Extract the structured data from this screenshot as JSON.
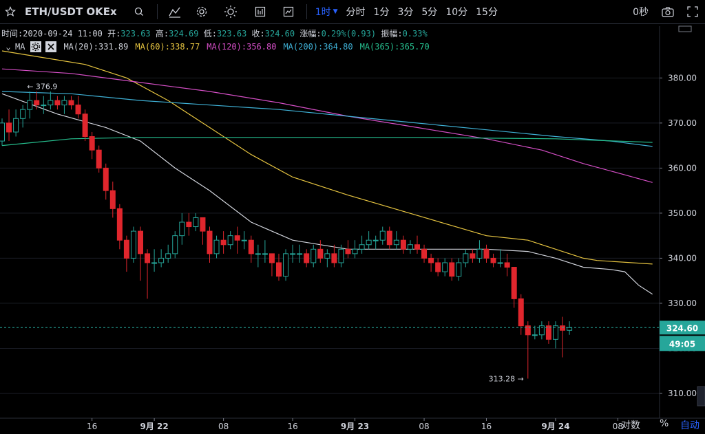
{
  "toolbar": {
    "symbol": "ETH/USDT OKEx",
    "intervals": [
      "1时",
      "分时",
      "1分",
      "3分",
      "5分",
      "10分",
      "15分"
    ],
    "active_interval": "1时",
    "countdown": "0秒"
  },
  "info": {
    "time_label": "时间:",
    "time": "2020-09-24 11:00",
    "open_label": "开:",
    "open": "323.63",
    "high_label": "高:",
    "high": "324.69",
    "low_label": "低:",
    "low": "323.63",
    "close_label": "收:",
    "close": "324.60",
    "change_label": "涨幅:",
    "change": "0.29%(0.93)",
    "amp_label": "振幅:",
    "amp": "0.33%"
  },
  "ma_legend": {
    "title": "MA",
    "items": [
      {
        "label": "MA(20):331.89",
        "color": "#d1d4dc"
      },
      {
        "label": "MA(60):338.77",
        "color": "#e6c440"
      },
      {
        "label": "MA(120):356.80",
        "color": "#d64fc7"
      },
      {
        "label": "MA(200):364.80",
        "color": "#3fb1d6"
      },
      {
        "label": "MA(365):365.70",
        "color": "#26c08f"
      }
    ]
  },
  "chart_data": {
    "type": "candlestick",
    "ylim": [
      304.5,
      391.5
    ],
    "yticks": [
      310,
      320,
      330,
      340,
      350,
      360,
      370,
      380
    ],
    "ytick_labels": [
      "310.00",
      "320.00",
      "330.00",
      "340.00",
      "350.00",
      "360.00",
      "370.00",
      "380.00"
    ],
    "xtick_labels": [
      "16",
      "9月 22",
      "08",
      "16",
      "9月 23",
      "08",
      "16",
      "9月 24",
      "08"
    ],
    "current_price": 324.6,
    "current_price_label": "324.60",
    "countdown_label": "49:05",
    "high_annotation": {
      "text": "← 376.9",
      "value": 376.9
    },
    "low_annotation": {
      "text": "313.28 →",
      "value": 313.28
    },
    "candles": [
      [
        366,
        370,
        371,
        365
      ],
      [
        370,
        368,
        373,
        366
      ],
      [
        368,
        371,
        373,
        367
      ],
      [
        371,
        373,
        374,
        369
      ],
      [
        373,
        375,
        377,
        371
      ],
      [
        375,
        374,
        377,
        373
      ],
      [
        374,
        374,
        376,
        372
      ],
      [
        374,
        375,
        377,
        373
      ],
      [
        375,
        374,
        376,
        373
      ],
      [
        374,
        375,
        376,
        372
      ],
      [
        375,
        374,
        376,
        373
      ],
      [
        374,
        372,
        376,
        371
      ],
      [
        372,
        367,
        373,
        366
      ],
      [
        367,
        364,
        368,
        362
      ],
      [
        364,
        360,
        365,
        359
      ],
      [
        360,
        355,
        361,
        353
      ],
      [
        355,
        351,
        357,
        349
      ],
      [
        351,
        344,
        352,
        342
      ],
      [
        344,
        340,
        345,
        337
      ],
      [
        340,
        346,
        347,
        339
      ],
      [
        346,
        341,
        347,
        335
      ],
      [
        341,
        339,
        342,
        331
      ],
      [
        339,
        339,
        342,
        337
      ],
      [
        339,
        340,
        342,
        338
      ],
      [
        340,
        341,
        343,
        339
      ],
      [
        341,
        345,
        346,
        340
      ],
      [
        345,
        348,
        350,
        343
      ],
      [
        348,
        347,
        350,
        345
      ],
      [
        347,
        349,
        350,
        346
      ],
      [
        349,
        346,
        349,
        343
      ],
      [
        346,
        341,
        347,
        339
      ],
      [
        341,
        344,
        345,
        340
      ],
      [
        344,
        343,
        346,
        341
      ],
      [
        343,
        345,
        346,
        342
      ],
      [
        345,
        344,
        347,
        341
      ],
      [
        344,
        344,
        346,
        342
      ],
      [
        344,
        341,
        345,
        339
      ],
      [
        341,
        341,
        343,
        338
      ],
      [
        341,
        341,
        344,
        339
      ],
      [
        341,
        339,
        341,
        336
      ],
      [
        339,
        336,
        341,
        335
      ],
      [
        336,
        341,
        342,
        335
      ],
      [
        341,
        341,
        343,
        339
      ],
      [
        341,
        341,
        343,
        339
      ],
      [
        341,
        339,
        342,
        338
      ],
      [
        339,
        342,
        343,
        338
      ],
      [
        342,
        340,
        344,
        339
      ],
      [
        340,
        341,
        342,
        338
      ],
      [
        341,
        339,
        343,
        338
      ],
      [
        339,
        342,
        343,
        338
      ],
      [
        342,
        341,
        344,
        340
      ],
      [
        341,
        342,
        344,
        340
      ],
      [
        342,
        343,
        345,
        341
      ],
      [
        343,
        344,
        346,
        342
      ],
      [
        344,
        344,
        345,
        342
      ],
      [
        344,
        346,
        347,
        343
      ],
      [
        346,
        343,
        347,
        342
      ],
      [
        343,
        344,
        346,
        342
      ],
      [
        344,
        342,
        345,
        341
      ],
      [
        342,
        343,
        344,
        341
      ],
      [
        343,
        342,
        345,
        341
      ],
      [
        342,
        340,
        343,
        339
      ],
      [
        340,
        339,
        341,
        337
      ],
      [
        339,
        337,
        340,
        336
      ],
      [
        337,
        339,
        340,
        336
      ],
      [
        339,
        336,
        340,
        335
      ],
      [
        336,
        339,
        340,
        335
      ],
      [
        339,
        341,
        342,
        338
      ],
      [
        341,
        340,
        342,
        339
      ],
      [
        340,
        342,
        344,
        339
      ],
      [
        342,
        340,
        343,
        339
      ],
      [
        340,
        339,
        341,
        338
      ],
      [
        339,
        339,
        342,
        338
      ],
      [
        339,
        338,
        341,
        336
      ],
      [
        338,
        331,
        338,
        329
      ],
      [
        331,
        325,
        332,
        323
      ],
      [
        325,
        323,
        326,
        313.28
      ],
      [
        323,
        323,
        325,
        322
      ],
      [
        323,
        325,
        326,
        322
      ],
      [
        325,
        322,
        326,
        321
      ],
      [
        322,
        325,
        326,
        320
      ],
      [
        325,
        324,
        327,
        318
      ],
      [
        324,
        324.6,
        326,
        323
      ]
    ],
    "series": [
      {
        "name": "MA(20)",
        "color": "#d1d4dc",
        "points": [
          [
            0,
            376.5
          ],
          [
            8,
            372
          ],
          [
            15,
            369
          ],
          [
            20,
            366
          ],
          [
            25,
            360
          ],
          [
            30,
            355
          ],
          [
            36,
            348
          ],
          [
            42,
            344
          ],
          [
            50,
            342
          ],
          [
            60,
            342
          ],
          [
            70,
            342
          ],
          [
            76,
            341.5
          ],
          [
            80,
            340
          ],
          [
            84,
            338
          ],
          [
            88,
            337.5
          ],
          [
            90,
            337
          ],
          [
            92,
            334
          ],
          [
            94,
            332
          ]
        ]
      },
      {
        "name": "MA(60)",
        "color": "#e6c440",
        "points": [
          [
            0,
            386
          ],
          [
            8,
            384
          ],
          [
            12,
            383
          ],
          [
            18,
            380
          ],
          [
            24,
            375
          ],
          [
            30,
            369
          ],
          [
            36,
            363
          ],
          [
            42,
            358
          ],
          [
            50,
            354
          ],
          [
            60,
            349.5
          ],
          [
            70,
            345
          ],
          [
            76,
            344
          ],
          [
            80,
            342
          ],
          [
            84,
            340
          ],
          [
            86,
            339.5
          ],
          [
            94,
            338.7
          ]
        ]
      },
      {
        "name": "MA(120)",
        "color": "#d64fc7",
        "points": [
          [
            0,
            382
          ],
          [
            10,
            381
          ],
          [
            20,
            379
          ],
          [
            30,
            377
          ],
          [
            40,
            374.5
          ],
          [
            50,
            371.5
          ],
          [
            60,
            369
          ],
          [
            70,
            366.5
          ],
          [
            78,
            364
          ],
          [
            84,
            361
          ],
          [
            90,
            358.5
          ],
          [
            94,
            356.8
          ]
        ]
      },
      {
        "name": "MA(200)",
        "color": "#3fb1d6",
        "points": [
          [
            0,
            377
          ],
          [
            10,
            376.5
          ],
          [
            20,
            375
          ],
          [
            30,
            374
          ],
          [
            40,
            373
          ],
          [
            50,
            371.5
          ],
          [
            60,
            370
          ],
          [
            70,
            368.5
          ],
          [
            80,
            367
          ],
          [
            88,
            366
          ],
          [
            94,
            364.8
          ]
        ]
      },
      {
        "name": "MA(365)",
        "color": "#26c08f",
        "points": [
          [
            0,
            365
          ],
          [
            10,
            366.5
          ],
          [
            20,
            366.8
          ],
          [
            40,
            366.8
          ],
          [
            60,
            366.8
          ],
          [
            80,
            366.5
          ],
          [
            94,
            365.7
          ]
        ]
      }
    ]
  }
}
